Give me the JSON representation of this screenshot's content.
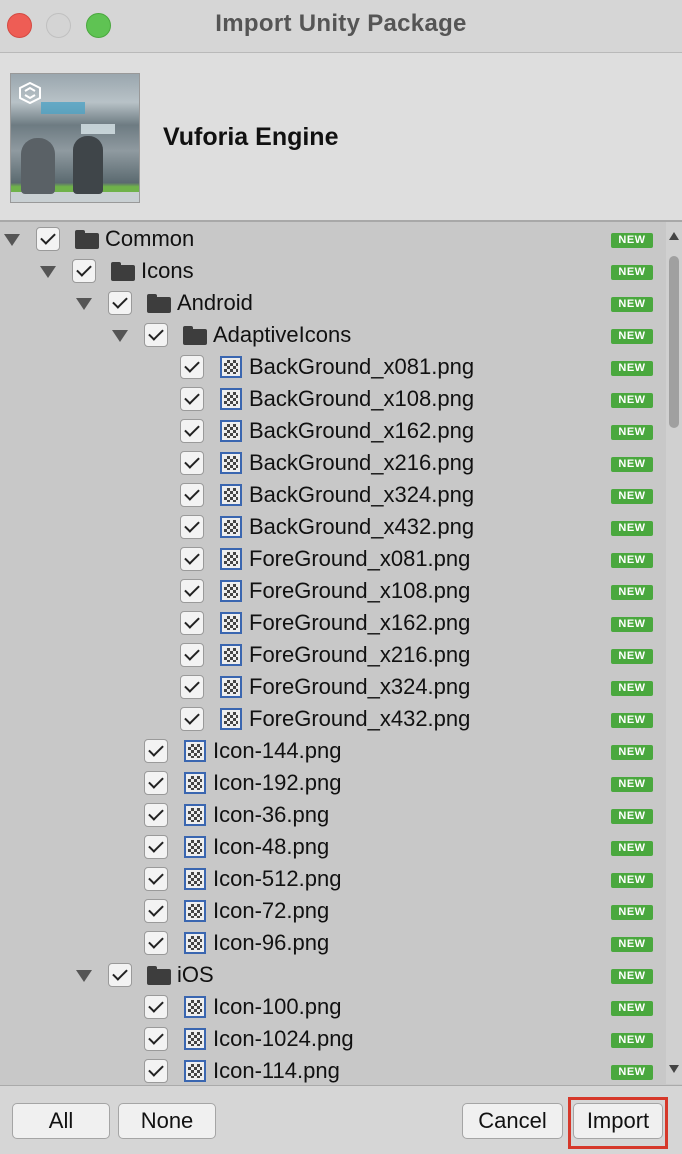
{
  "window": {
    "title": "Import Unity Package"
  },
  "package": {
    "name": "Vuforia Engine"
  },
  "badge_text": "NEW",
  "tree": [
    {
      "label": "Common",
      "type": "folder",
      "depth": 0,
      "expanded": true,
      "checked": true
    },
    {
      "label": "Icons",
      "type": "folder",
      "depth": 1,
      "expanded": true,
      "checked": true
    },
    {
      "label": "Android",
      "type": "folder",
      "depth": 2,
      "expanded": true,
      "checked": true
    },
    {
      "label": "AdaptiveIcons",
      "type": "folder",
      "depth": 3,
      "expanded": true,
      "checked": true
    },
    {
      "label": "BackGround_x081.png",
      "type": "file",
      "depth": 4,
      "checked": true
    },
    {
      "label": "BackGround_x108.png",
      "type": "file",
      "depth": 4,
      "checked": true
    },
    {
      "label": "BackGround_x162.png",
      "type": "file",
      "depth": 4,
      "checked": true
    },
    {
      "label": "BackGround_x216.png",
      "type": "file",
      "depth": 4,
      "checked": true
    },
    {
      "label": "BackGround_x324.png",
      "type": "file",
      "depth": 4,
      "checked": true
    },
    {
      "label": "BackGround_x432.png",
      "type": "file",
      "depth": 4,
      "checked": true
    },
    {
      "label": "ForeGround_x081.png",
      "type": "file",
      "depth": 4,
      "checked": true
    },
    {
      "label": "ForeGround_x108.png",
      "type": "file",
      "depth": 4,
      "checked": true
    },
    {
      "label": "ForeGround_x162.png",
      "type": "file",
      "depth": 4,
      "checked": true
    },
    {
      "label": "ForeGround_x216.png",
      "type": "file",
      "depth": 4,
      "checked": true
    },
    {
      "label": "ForeGround_x324.png",
      "type": "file",
      "depth": 4,
      "checked": true
    },
    {
      "label": "ForeGround_x432.png",
      "type": "file",
      "depth": 4,
      "checked": true
    },
    {
      "label": "Icon-144.png",
      "type": "file",
      "depth": 3,
      "checked": true
    },
    {
      "label": "Icon-192.png",
      "type": "file",
      "depth": 3,
      "checked": true
    },
    {
      "label": "Icon-36.png",
      "type": "file",
      "depth": 3,
      "checked": true
    },
    {
      "label": "Icon-48.png",
      "type": "file",
      "depth": 3,
      "checked": true
    },
    {
      "label": "Icon-512.png",
      "type": "file",
      "depth": 3,
      "checked": true
    },
    {
      "label": "Icon-72.png",
      "type": "file",
      "depth": 3,
      "checked": true
    },
    {
      "label": "Icon-96.png",
      "type": "file",
      "depth": 3,
      "checked": true
    },
    {
      "label": "iOS",
      "type": "folder",
      "depth": 2,
      "expanded": true,
      "checked": true
    },
    {
      "label": "Icon-100.png",
      "type": "file",
      "depth": 3,
      "checked": true
    },
    {
      "label": "Icon-1024.png",
      "type": "file",
      "depth": 3,
      "checked": true
    },
    {
      "label": "Icon-114.png",
      "type": "file",
      "depth": 3,
      "checked": true
    }
  ],
  "buttons": {
    "all": "All",
    "none": "None",
    "cancel": "Cancel",
    "import": "Import"
  },
  "colors": {
    "badge": "#4aa83e",
    "highlight": "#d6382a",
    "file_icon_border": "#3a66b0"
  }
}
